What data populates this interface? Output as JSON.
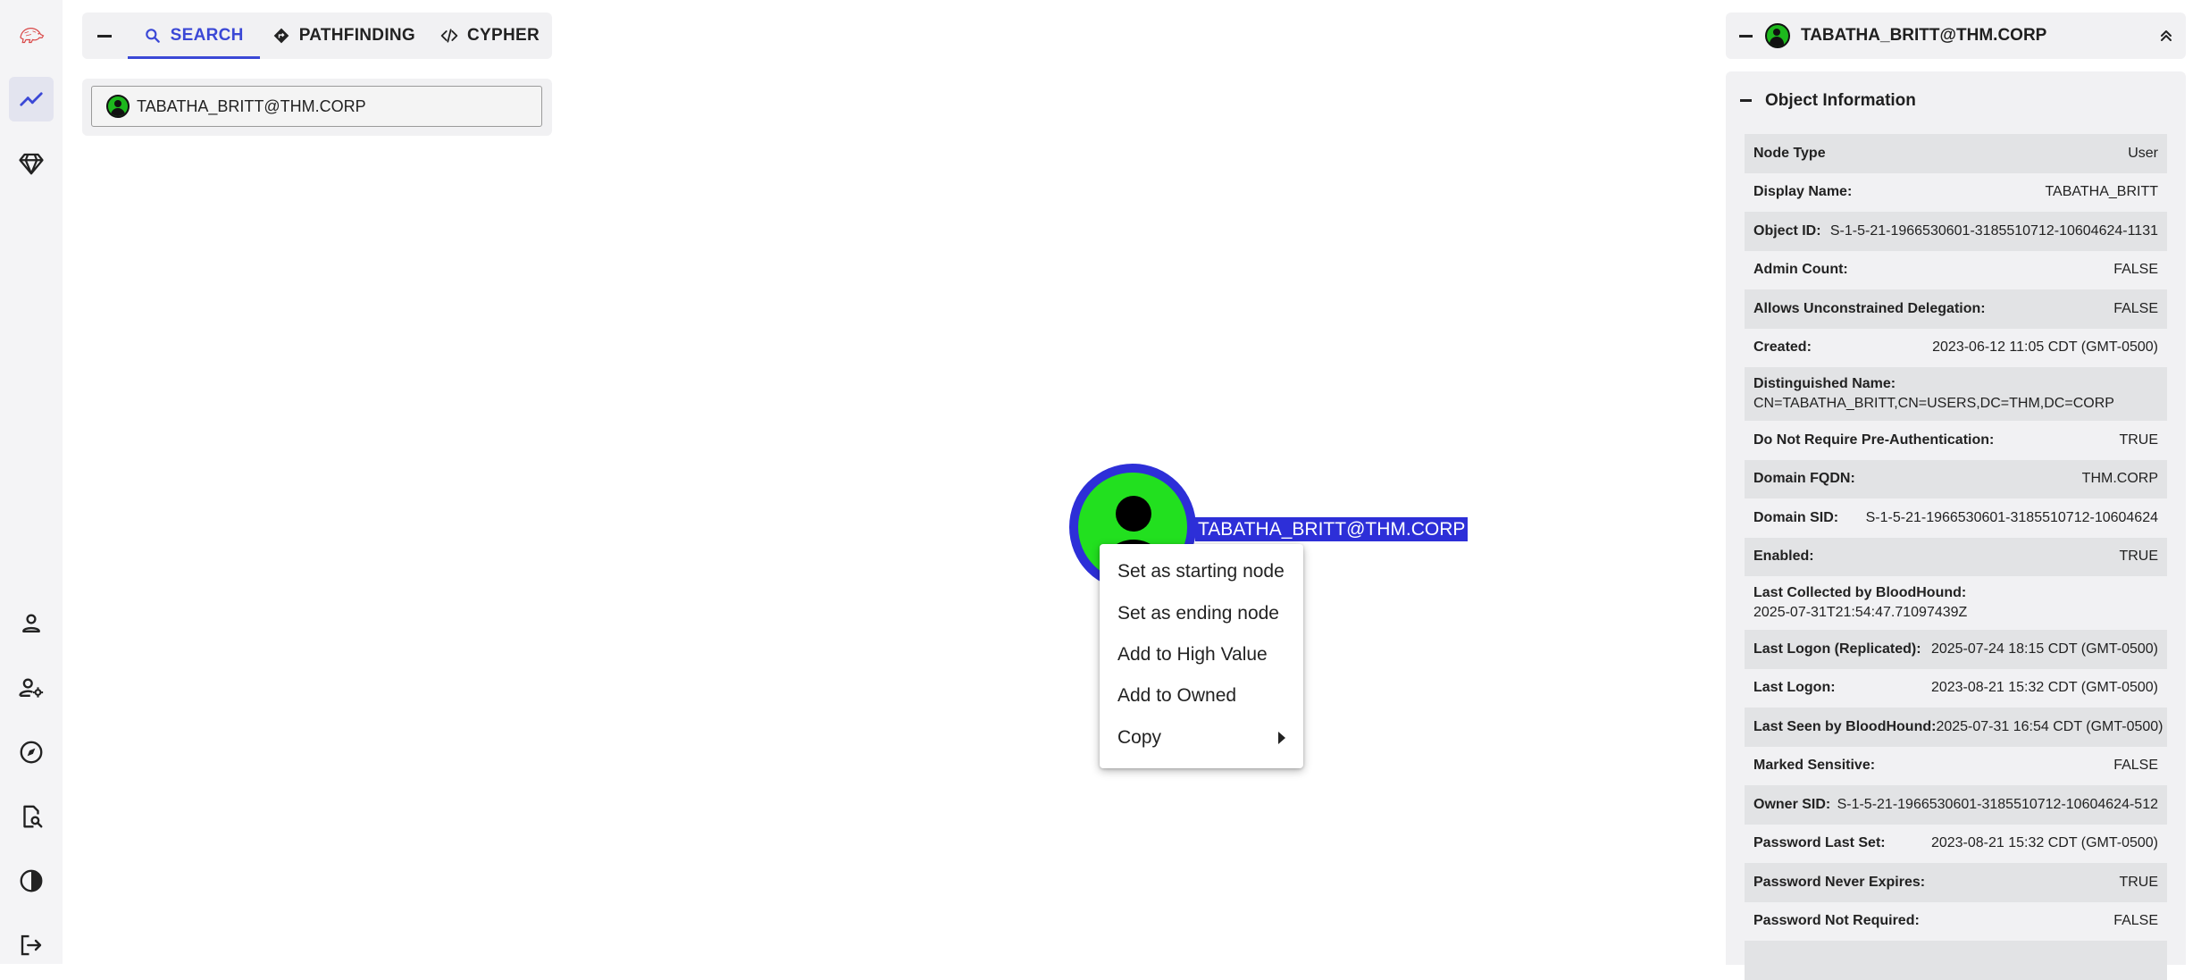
{
  "colors": {
    "accent": "#3b48d6",
    "node_ring": "#2d2fd8",
    "node_fill": "#22e01f"
  },
  "left_rail": {
    "top_items": [
      {
        "name": "logo-icon"
      },
      {
        "name": "explore-icon",
        "active": true
      },
      {
        "name": "gem-icon"
      }
    ],
    "bottom_items": [
      {
        "name": "user-icon"
      },
      {
        "name": "user-settings-icon"
      },
      {
        "name": "compass-icon"
      },
      {
        "name": "file-search-icon"
      },
      {
        "name": "contrast-icon"
      },
      {
        "name": "logout-icon"
      }
    ]
  },
  "search": {
    "tabs": [
      {
        "label": "SEARCH",
        "icon": "search-icon",
        "active": true
      },
      {
        "label": "PATHFINDING",
        "icon": "diamond-turn-icon"
      },
      {
        "label": "CYPHER",
        "icon": "code-icon"
      }
    ],
    "input_value": "TABATHA_BRITT@THM.CORP"
  },
  "graph": {
    "node_label": "TABATHA_BRITT@THM.CORP"
  },
  "context_menu": {
    "items": [
      "Set as starting node",
      "Set as ending node",
      "Add to High Value",
      "Add to Owned",
      "Copy"
    ]
  },
  "entity_panel": {
    "title": "TABATHA_BRITT@THM.CORP",
    "section_title": "Object Information",
    "properties": [
      {
        "key": "Node Type",
        "value": "User"
      },
      {
        "key": "Display Name:",
        "value": "TABATHA_BRITT"
      },
      {
        "key": "Object ID:",
        "value": "S-1-5-21-1966530601-3185510712-10604624-1131"
      },
      {
        "key": "Admin Count:",
        "value": "FALSE"
      },
      {
        "key": "Allows Unconstrained Delegation:",
        "value": "FALSE"
      },
      {
        "key": "Created:",
        "value": "2023-06-12 11:05 CDT (GMT-0500)"
      },
      {
        "key": "Distinguished Name:",
        "value": "CN=TABATHA_BRITT,CN=USERS,DC=THM,DC=CORP",
        "stacked": true
      },
      {
        "key": "Do Not Require Pre-Authentication:",
        "value": "TRUE"
      },
      {
        "key": "Domain FQDN:",
        "value": "THM.CORP"
      },
      {
        "key": "Domain SID:",
        "value": "S-1-5-21-1966530601-3185510712-10604624"
      },
      {
        "key": "Enabled:",
        "value": "TRUE"
      },
      {
        "key": "Last Collected by BloodHound:",
        "value": "2025-07-31T21:54:47.71097439Z",
        "stacked": true
      },
      {
        "key": "Last Logon (Replicated):",
        "value": "2025-07-24 18:15 CDT (GMT-0500)"
      },
      {
        "key": "Last Logon:",
        "value": "2023-08-21 15:32 CDT (GMT-0500)"
      },
      {
        "key": "Last Seen by BloodHound:",
        "value": "2025-07-31 16:54 CDT (GMT-0500)"
      },
      {
        "key": "Marked Sensitive:",
        "value": "FALSE"
      },
      {
        "key": "Owner SID:",
        "value": "S-1-5-21-1966530601-3185510712-10604624-512"
      },
      {
        "key": "Password Last Set:",
        "value": "2023-08-21 15:32 CDT (GMT-0500)"
      },
      {
        "key": "Password Never Expires:",
        "value": "TRUE"
      },
      {
        "key": "Password Not Required:",
        "value": "FALSE"
      },
      {
        "key": "",
        "value": ""
      }
    ]
  }
}
